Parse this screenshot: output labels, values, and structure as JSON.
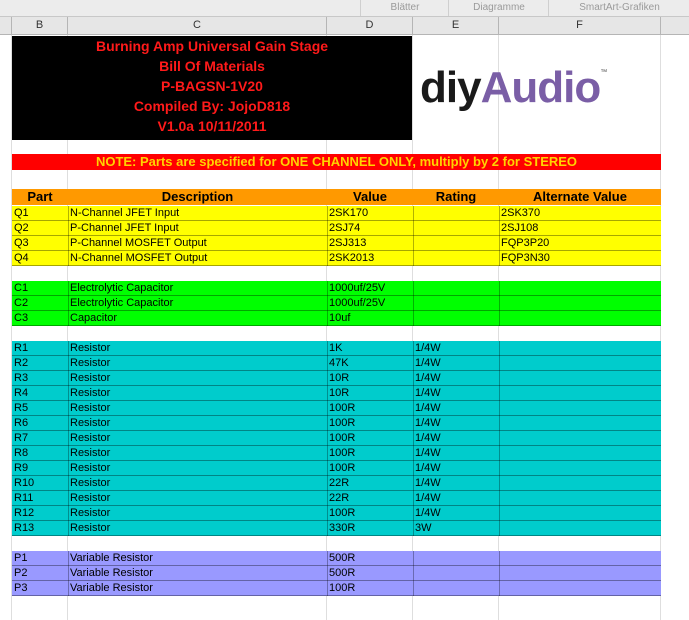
{
  "ribbon": {
    "tabs": [
      "Blätter",
      "Diagramme",
      "SmartArt-Grafiken"
    ]
  },
  "columns": [
    "B",
    "C",
    "D",
    "E",
    "F"
  ],
  "title_lines": [
    "Burning Amp Universal Gain Stage",
    "Bill Of Materials",
    "P-BAGSN-1V20",
    "Compiled By: JojoD818",
    "V1.0a 10/11/2011"
  ],
  "logo": {
    "part1": "diy",
    "part2": "Audio",
    "tm": "™"
  },
  "note": "NOTE: Parts are specified for ONE CHANNEL ONLY, multiply by 2 for STEREO",
  "header": {
    "part": "Part",
    "description": "Description",
    "value": "Value",
    "rating": "Rating",
    "alternate": "Alternate Value"
  },
  "colors": {
    "transistor": "#ffff00",
    "capacitor": "#00ff00",
    "resistor": "#00cccc",
    "pot": "#9999ff",
    "header": "#ff9900",
    "note_bg": "#ff0000",
    "note_text": "#ffd400",
    "title_text": "#ff1a1a"
  },
  "groups": [
    {
      "color_key": "transistor",
      "rows": [
        {
          "part": "Q1",
          "desc": "N-Channel JFET Input",
          "value": "2SK170",
          "rating": "",
          "alt": "2SK370"
        },
        {
          "part": "Q2",
          "desc": "P-Channel JFET Input",
          "value": "2SJ74",
          "rating": "",
          "alt": "2SJ108"
        },
        {
          "part": "Q3",
          "desc": "P-Channel MOSFET Output",
          "value": "2SJ313",
          "rating": "",
          "alt": "FQP3P20"
        },
        {
          "part": "Q4",
          "desc": "N-Channel MOSFET Output",
          "value": "2SK2013",
          "rating": "",
          "alt": "FQP3N30"
        }
      ]
    },
    {
      "color_key": "capacitor",
      "rows": [
        {
          "part": "C1",
          "desc": "Electrolytic Capacitor",
          "value": "1000uf/25V",
          "rating": "",
          "alt": ""
        },
        {
          "part": "C2",
          "desc": "Electrolytic Capacitor",
          "value": "1000uf/25V",
          "rating": "",
          "alt": ""
        },
        {
          "part": "C3",
          "desc": "Capacitor",
          "value": "10uf",
          "rating": "",
          "alt": ""
        }
      ]
    },
    {
      "color_key": "resistor",
      "rows": [
        {
          "part": "R1",
          "desc": "Resistor",
          "value": "1K",
          "rating": "1/4W",
          "alt": ""
        },
        {
          "part": "R2",
          "desc": "Resistor",
          "value": "47K",
          "rating": "1/4W",
          "alt": ""
        },
        {
          "part": "R3",
          "desc": "Resistor",
          "value": "10R",
          "rating": "1/4W",
          "alt": ""
        },
        {
          "part": "R4",
          "desc": "Resistor",
          "value": "10R",
          "rating": "1/4W",
          "alt": ""
        },
        {
          "part": "R5",
          "desc": "Resistor",
          "value": "100R",
          "rating": "1/4W",
          "alt": ""
        },
        {
          "part": "R6",
          "desc": "Resistor",
          "value": "100R",
          "rating": "1/4W",
          "alt": ""
        },
        {
          "part": "R7",
          "desc": "Resistor",
          "value": "100R",
          "rating": "1/4W",
          "alt": ""
        },
        {
          "part": "R8",
          "desc": "Resistor",
          "value": "100R",
          "rating": "1/4W",
          "alt": ""
        },
        {
          "part": "R9",
          "desc": "Resistor",
          "value": "100R",
          "rating": "1/4W",
          "alt": ""
        },
        {
          "part": "R10",
          "desc": "Resistor",
          "value": "22R",
          "rating": "1/4W",
          "alt": ""
        },
        {
          "part": "R11",
          "desc": "Resistor",
          "value": "22R",
          "rating": "1/4W",
          "alt": ""
        },
        {
          "part": "R12",
          "desc": "Resistor",
          "value": "100R",
          "rating": "1/4W",
          "alt": ""
        },
        {
          "part": "R13",
          "desc": "Resistor",
          "value": "330R",
          "rating": "3W",
          "alt": ""
        }
      ]
    },
    {
      "color_key": "pot",
      "rows": [
        {
          "part": "P1",
          "desc": "Variable Resistor",
          "value": "500R",
          "rating": "",
          "alt": ""
        },
        {
          "part": "P2",
          "desc": "Variable Resistor",
          "value": "500R",
          "rating": "",
          "alt": ""
        },
        {
          "part": "P3",
          "desc": "Variable Resistor",
          "value": "100R",
          "rating": "",
          "alt": ""
        }
      ]
    }
  ]
}
